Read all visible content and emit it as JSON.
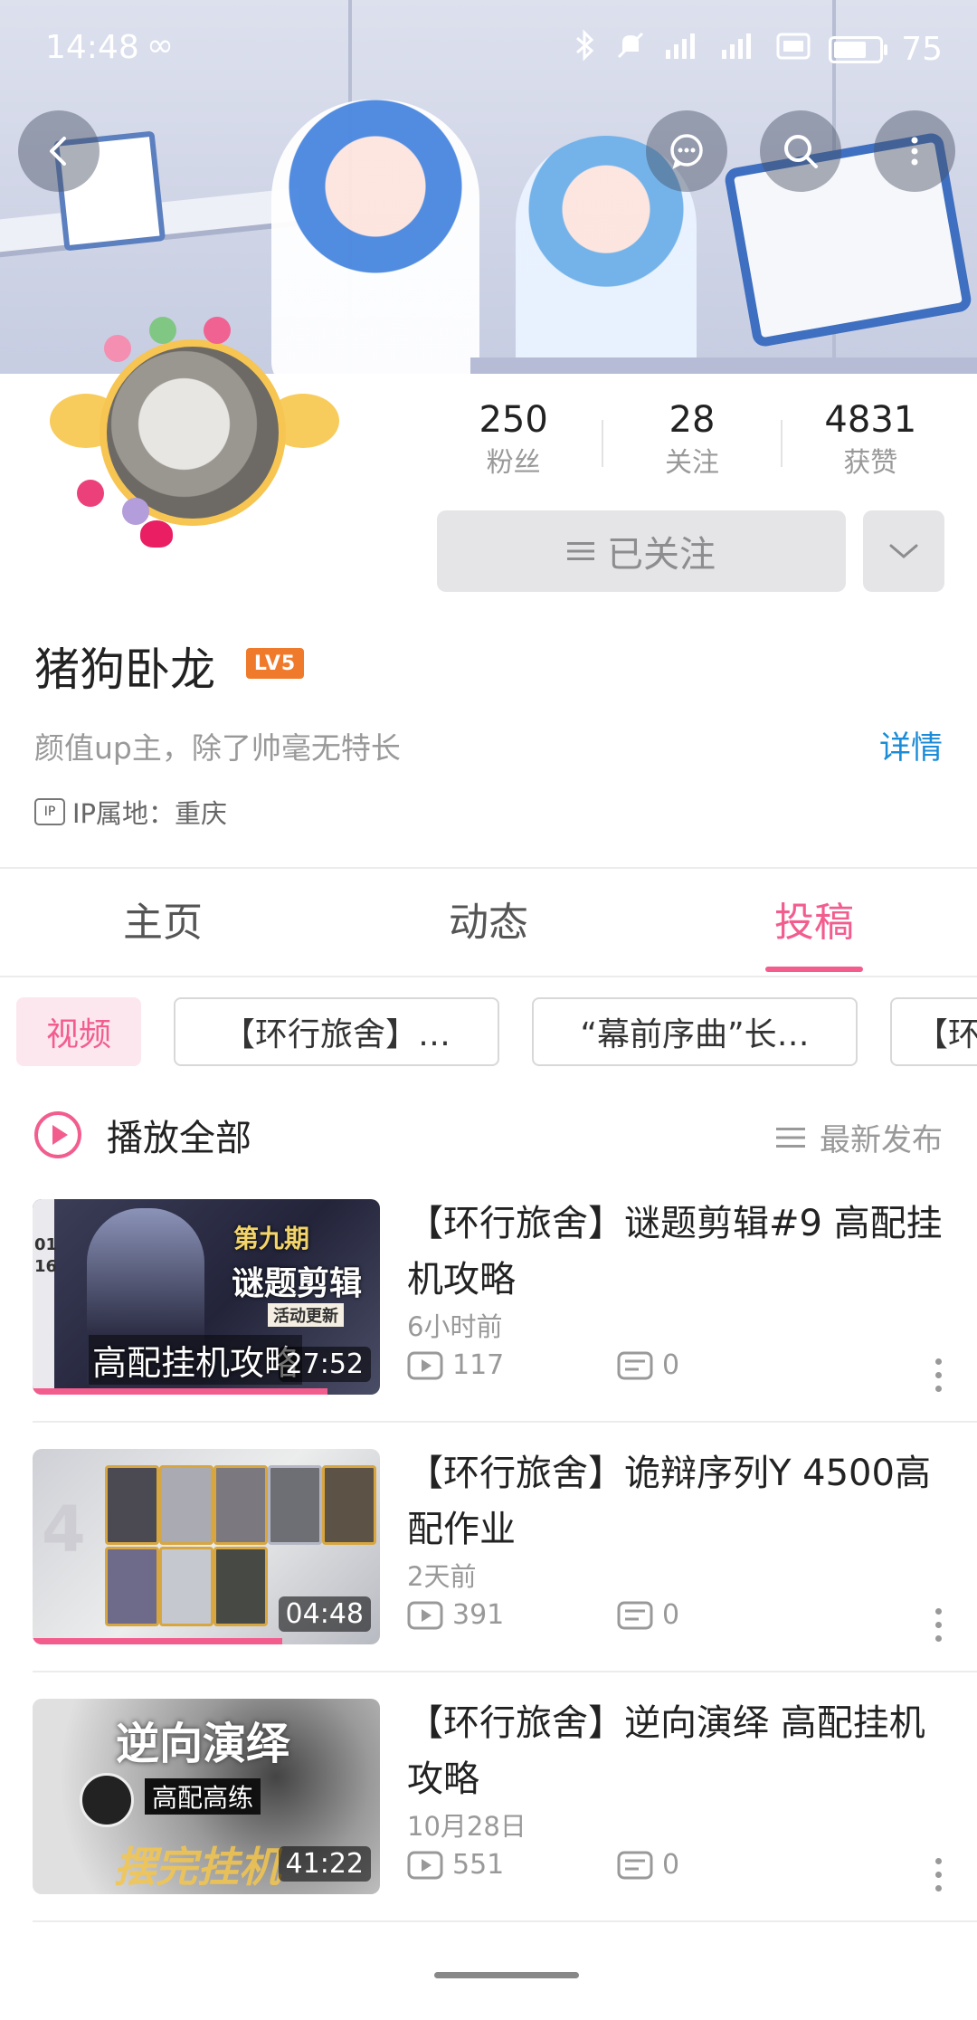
{
  "status_bar": {
    "time": "14:48",
    "battery": "75",
    "battery_level": 0.75
  },
  "header_actions": [
    "back-icon",
    "message-icon",
    "search-icon",
    "more-vertical-icon"
  ],
  "profile": {
    "name": "猪狗卧龙",
    "level_badge": "LV5",
    "bio": "颜值up主，除了帅毫无特长",
    "details_label": "详情",
    "ip_label": "IP属地：重庆",
    "ip_icon_text": "IP",
    "stats": [
      {
        "value": "250",
        "label": "粉丝"
      },
      {
        "value": "28",
        "label": "关注"
      },
      {
        "value": "4831",
        "label": "获赞"
      }
    ],
    "follow_button": "已关注"
  },
  "tabs": [
    {
      "label": "主页",
      "active": false
    },
    {
      "label": "动态",
      "active": false
    },
    {
      "label": "投稿",
      "active": true
    }
  ],
  "chips": [
    {
      "label": "视频",
      "active": true
    },
    {
      "label": "【环行旅舍】…",
      "active": false
    },
    {
      "label": "“幕前序曲”长…",
      "active": false
    },
    {
      "label": "【环",
      "active": false
    }
  ],
  "play_all_label": "播放全部",
  "sort_label": "最新发布",
  "videos": [
    {
      "title": "【环行旅舍】谜题剪辑#9 高配挂机攻略",
      "time": "6小时前",
      "views": "117",
      "comments": "0",
      "duration": "27:52",
      "watched_fraction": 0.85,
      "thumb_texts": [
        "第九期",
        "谜题剪辑",
        "活动更新",
        "高配挂机攻略",
        "01",
        "16"
      ]
    },
    {
      "title": "【环行旅舍】诡辩序列Y 4500高配作业",
      "time": "2天前",
      "views": "391",
      "comments": "0",
      "duration": "04:48",
      "watched_fraction": 0.72,
      "thumb_texts": [
        "4"
      ]
    },
    {
      "title": "【环行旅舍】逆向演绎 高配挂机攻略",
      "time": "10月28日",
      "views": "551",
      "comments": "0",
      "duration": "41:22",
      "watched_fraction": 0,
      "thumb_texts": [
        "逆向演绎",
        "高配高练",
        "摆完挂机"
      ]
    }
  ],
  "colors": {
    "accent": "#f25d8e",
    "link": "#1a8cd8",
    "level_badge": "#f07a2b"
  }
}
